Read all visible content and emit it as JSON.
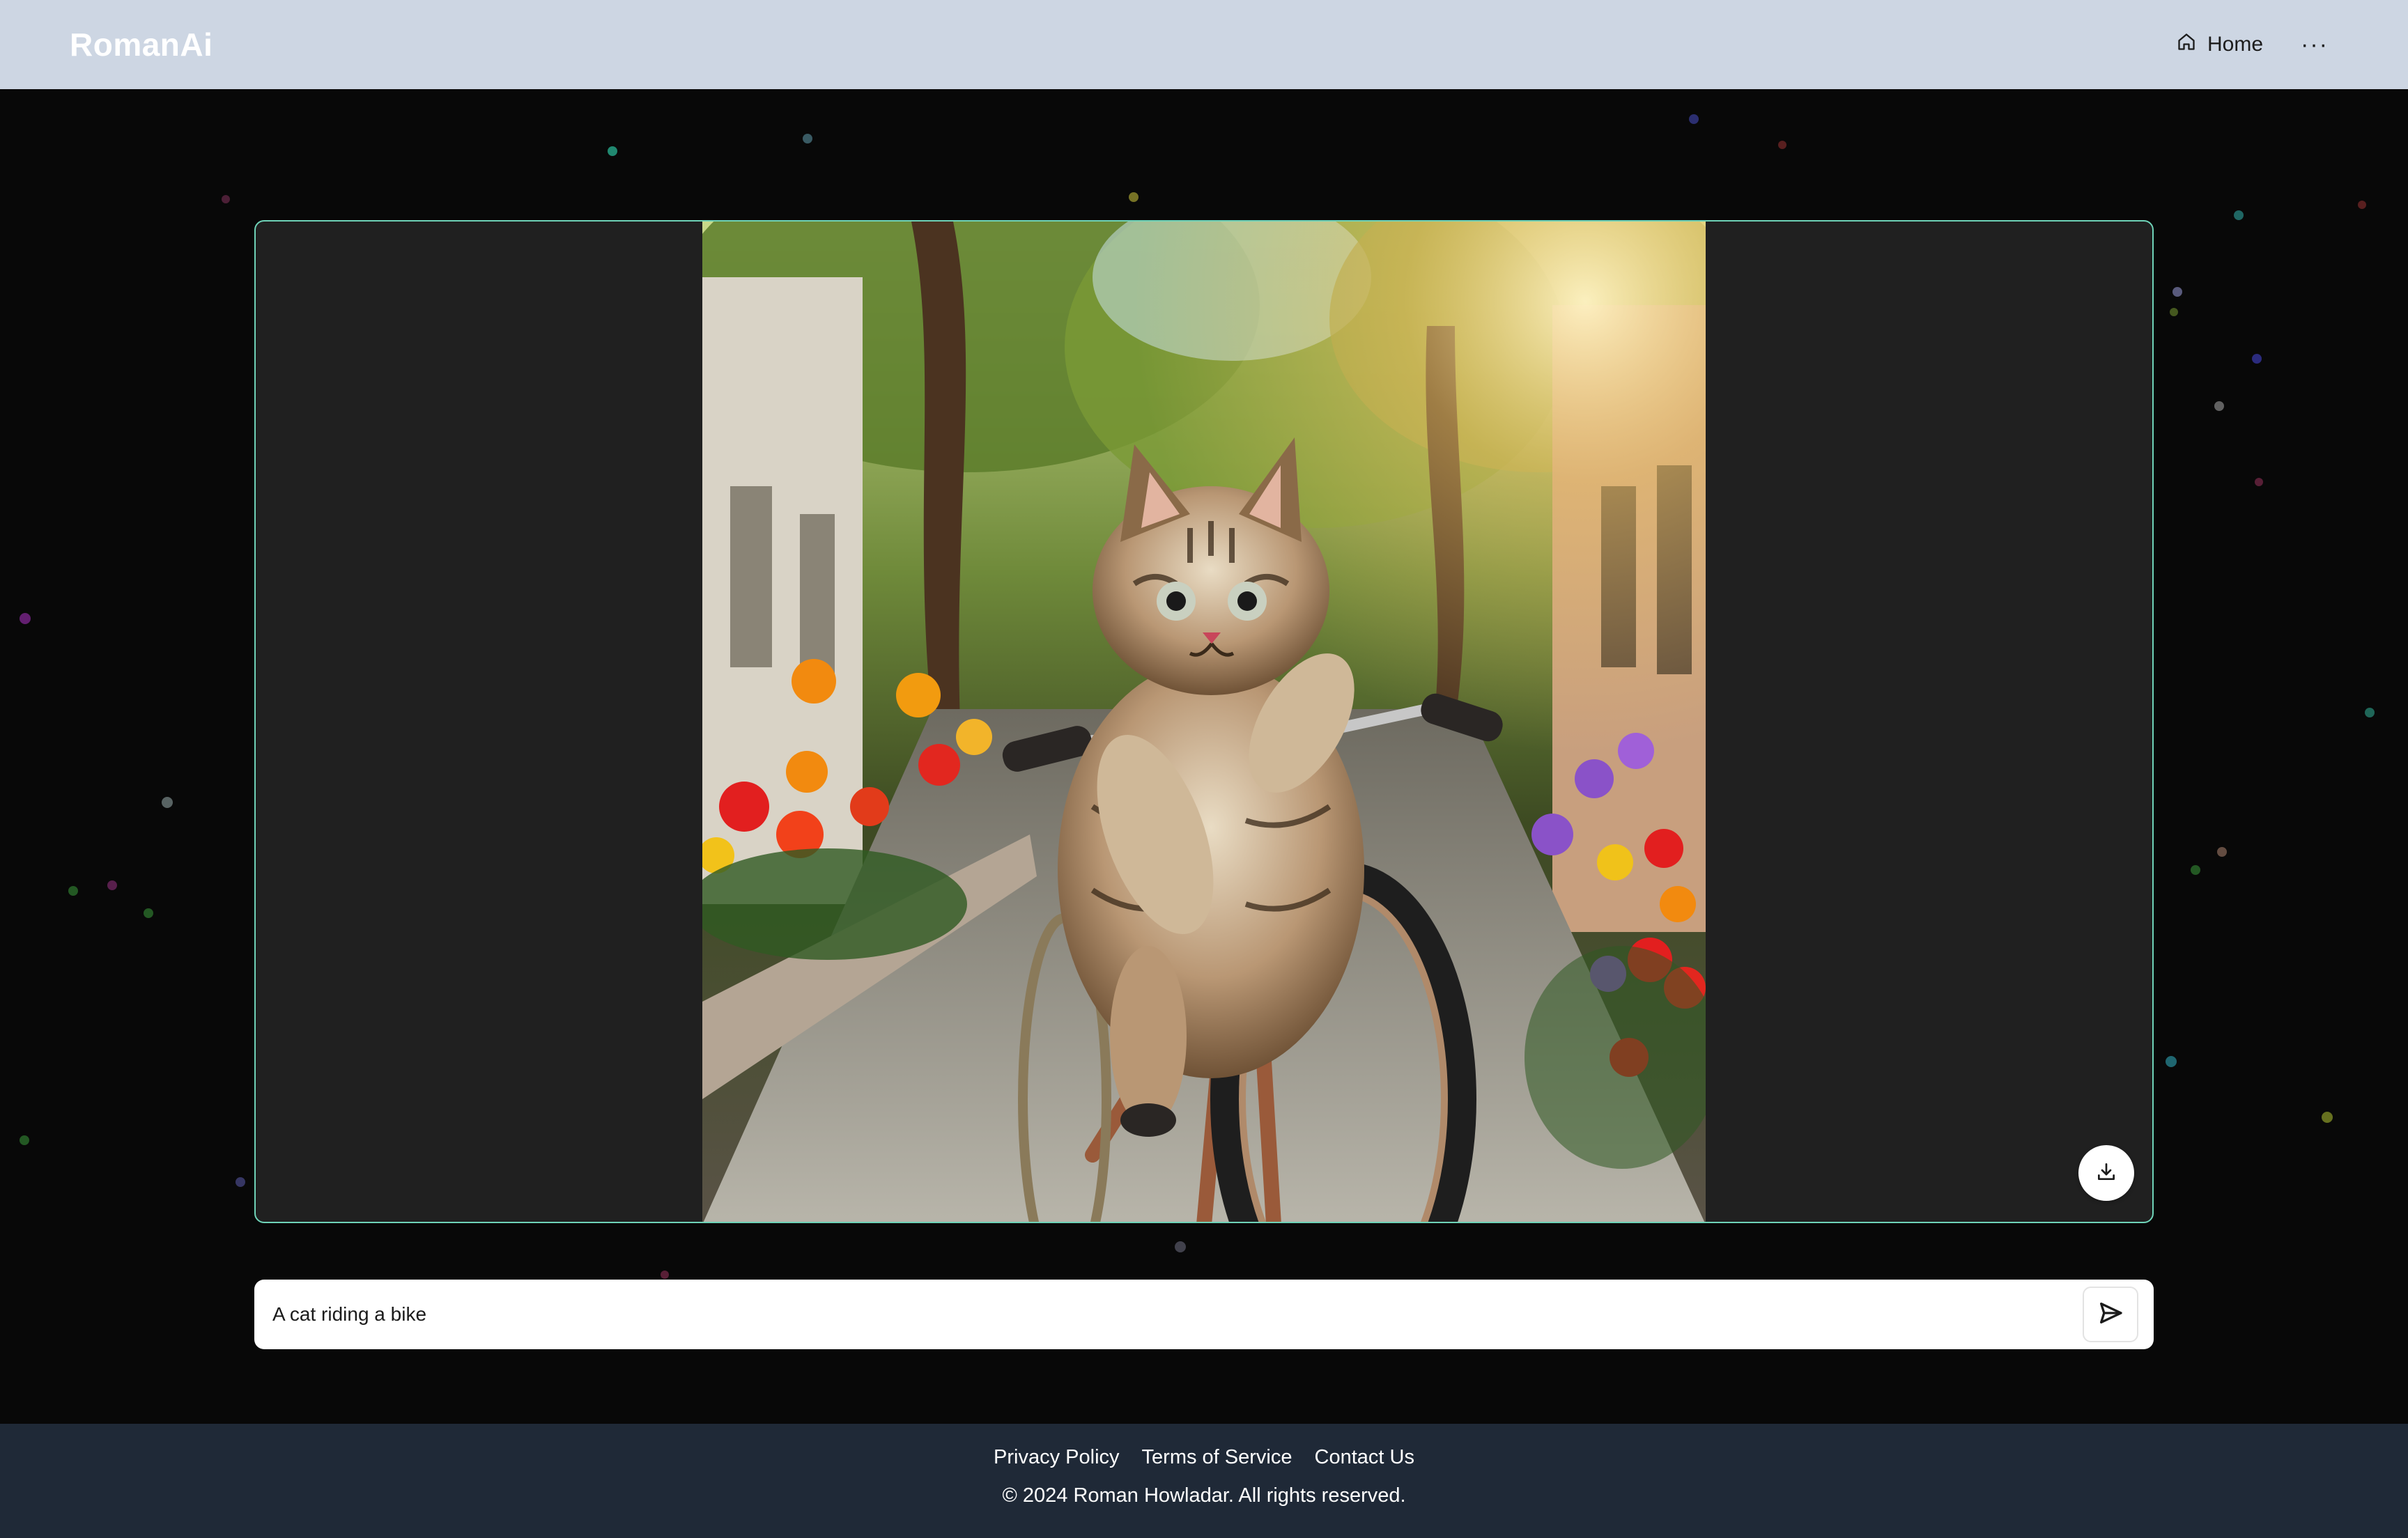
{
  "header": {
    "brand": "RomanAi",
    "nav": {
      "home_label": "Home",
      "more_label": "···"
    }
  },
  "main": {
    "image": {
      "alt": "A cat riding a bike"
    },
    "download_icon": "download-icon",
    "prompt": {
      "value": "A cat riding a bike",
      "placeholder": ""
    },
    "send_icon": "send-icon"
  },
  "footer": {
    "links": [
      "Privacy Policy",
      "Terms of Service",
      "Contact Us"
    ],
    "copyright": "© 2024 Roman Howladar. All rights reserved."
  },
  "colors": {
    "header_bg": "#cdd6e3",
    "page_bg": "#080808",
    "card_border": "#6fd3b8",
    "footer_bg": "#1f2937"
  }
}
